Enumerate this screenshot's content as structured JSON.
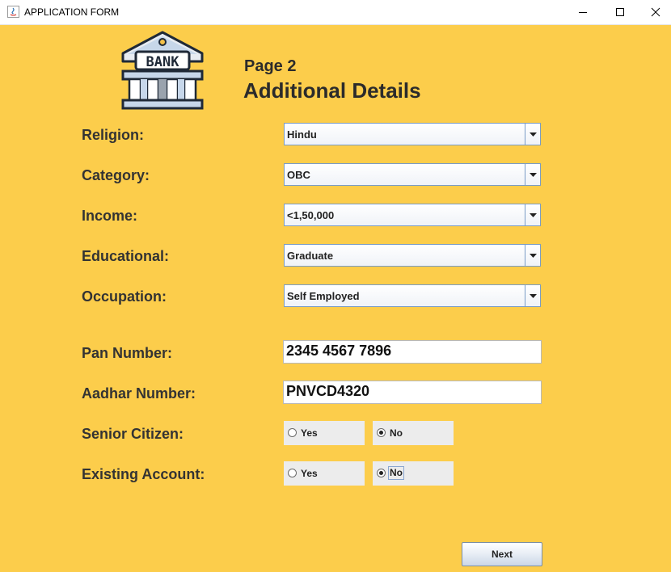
{
  "window": {
    "title": "APPLICATION FORM",
    "minimize_glyph": "–",
    "maximize_glyph": "☐",
    "close_glyph": "✕"
  },
  "logo": {
    "text": "BANK"
  },
  "header": {
    "page": "Page 2",
    "title": "Additional Details"
  },
  "fields": {
    "religion": {
      "label": "Religion:",
      "value": "Hindu"
    },
    "category": {
      "label": "Category:",
      "value": "OBC"
    },
    "income": {
      "label": "Income:",
      "value": "<1,50,000"
    },
    "educational": {
      "label": "Educational:",
      "value": "Graduate"
    },
    "occupation": {
      "label": "Occupation:",
      "value": "Self Employed"
    },
    "pan": {
      "label": "Pan Number:",
      "value": "2345 4567 7896"
    },
    "aadhar": {
      "label": "Aadhar Number:",
      "value": "PNVCD4320"
    },
    "senior_citizen": {
      "label": "Senior Citizen:",
      "yes": "Yes",
      "no": "No",
      "selected": "No"
    },
    "existing_account": {
      "label": "Existing Account:",
      "yes": "Yes",
      "no": "No",
      "selected": "No"
    }
  },
  "buttons": {
    "next": "Next"
  },
  "colors": {
    "background": "#fccd4b",
    "combo_border": "#7a9cc6",
    "label_text": "#333333"
  }
}
